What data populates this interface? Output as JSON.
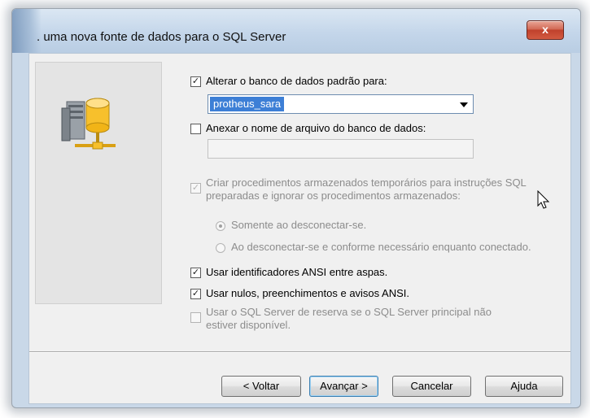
{
  "window": {
    "title": "uma nova fonte de dados para o SQL Server",
    "title_prefix": ".",
    "close_label": "x"
  },
  "options": {
    "change_default_db": {
      "label": "Alterar o banco de dados padrão para:",
      "checked": true,
      "value": "protheus_sara"
    },
    "attach_db_file": {
      "label": "Anexar o nome de arquivo do banco de dados:",
      "checked": false,
      "value": ""
    },
    "create_temp_procs": {
      "label_line1": "Criar procedimentos armazenados temporários para instruções SQL",
      "label_line2": "preparadas e ignorar os procedimentos armazenados:",
      "checked": true,
      "enabled": false
    },
    "radio_only_disconnect": {
      "label": "Somente ao desconectar-se.",
      "selected": true
    },
    "radio_disconnect_and_needed": {
      "label": "Ao desconectar-se e conforme necessário enquanto conectado.",
      "selected": false
    },
    "ansi_quoted": {
      "label": "Usar identificadores ANSI entre aspas.",
      "checked": true
    },
    "ansi_nulls": {
      "label": "Usar nulos, preenchimentos e avisos ANSI.",
      "checked": true
    },
    "failover": {
      "label_line1": "Usar o SQL Server de reserva se o SQL Server principal não",
      "label_line2": "estiver disponível.",
      "checked": false,
      "enabled": false
    }
  },
  "buttons": {
    "back": "< Voltar",
    "next": "Avançar >",
    "cancel": "Cancelar",
    "help": "Ajuda"
  },
  "check_mark": "✓",
  "colors": {
    "selection": "#3d7fd6",
    "close_button": "#c0412c",
    "dialog_bg": "#f0f0f0"
  },
  "icons": [
    "server-database-icon",
    "mouse-pointer-icon"
  ]
}
